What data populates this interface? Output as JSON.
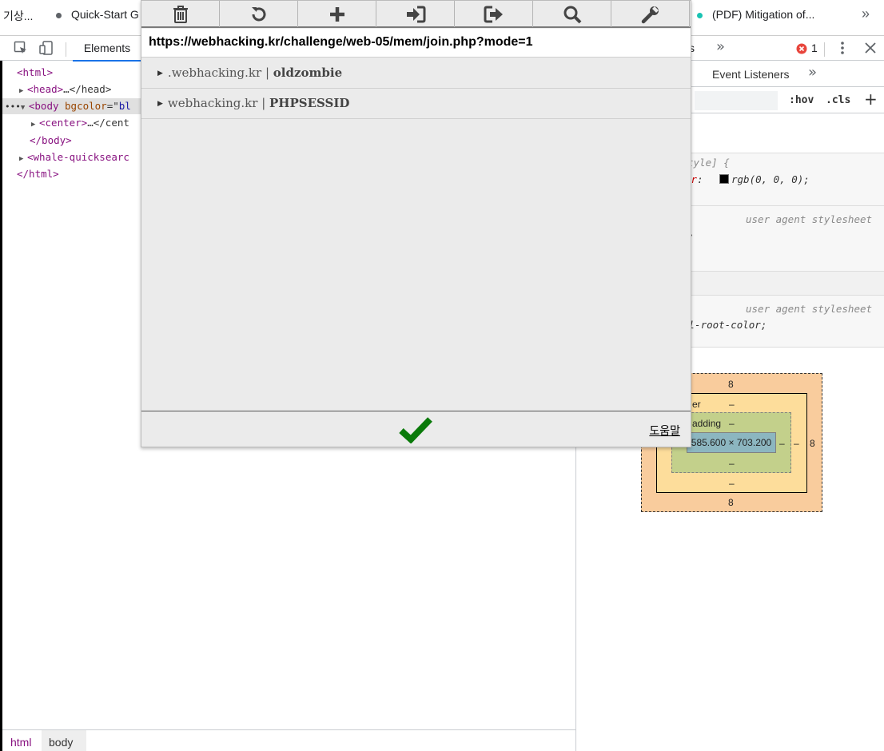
{
  "bookmarks": [
    {
      "label": "기상..."
    },
    {
      "label": "Quick-Start G"
    },
    {
      "label": "(PDF) Mitigation of..."
    }
  ],
  "devtools": {
    "elements_tab": "Elements",
    "partial_tab": "s",
    "error_count": "1",
    "event_listeners_tab": "Event Listeners",
    "filter_hov": ":hov",
    "filter_cls": ".cls",
    "dom": {
      "line1": "<html>",
      "line2_tag": "<head>",
      "line2_tail": "…</head>",
      "line3_open": "<body ",
      "line3_attr": "bgcolor",
      "line3_eq": "=\"",
      "line3_val": "bl",
      "line4_tag": "<center>",
      "line4_tail": "…</cent",
      "line5": "</body>",
      "line6": "<whale-quicksearc",
      "line7": "</html>"
    },
    "styles": {
      "rule1_selector": "tyle] {",
      "rule1_prop": "or",
      "rule1_colon": ": ",
      "rule1_value": "rgb(0, 0, 0);",
      "ua_label_1": "user agent stylesheet",
      "rule2_frag": ";",
      "ua_label_2": "user agent stylesheet",
      "rule3_frag": "al-root-color;"
    },
    "box_model": {
      "margin_top": "8",
      "margin_bottom": "8",
      "margin_right": "8",
      "border_label": "er",
      "border_top": "–",
      "border_bottom": "–",
      "padding_label": "adding",
      "padding_top": "–",
      "padding_bottom": "–",
      "padding_right": "–",
      "border_right": "–",
      "content_size": "585.600 × 703.200"
    },
    "breadcrumbs": [
      "html",
      "body"
    ]
  },
  "popup": {
    "url": "https://webhacking.kr/challenge/web-05/mem/join.php?mode=1",
    "cookies": [
      {
        "domain": ".webhacking.kr",
        "name": "oldzombie"
      },
      {
        "domain": "webhacking.kr",
        "name": "PHPSESSID"
      }
    ],
    "help_label": "도움말",
    "colors": {
      "confirm": "#0a7a0a"
    }
  }
}
